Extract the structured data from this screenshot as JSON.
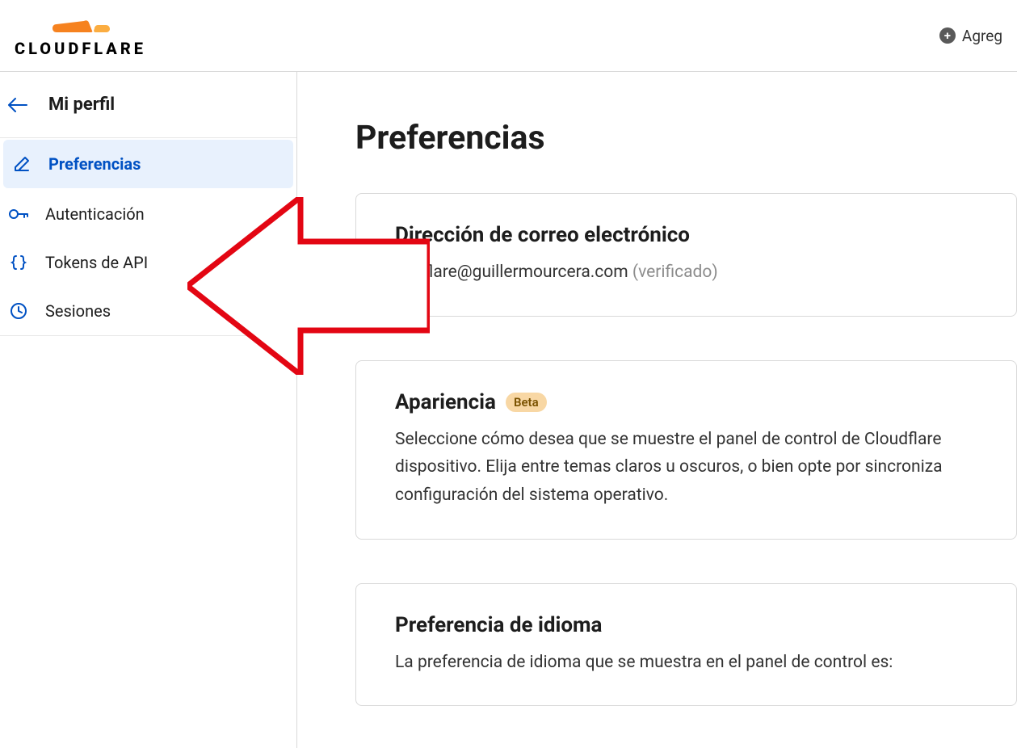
{
  "header": {
    "brand": "CLOUDFLARE",
    "action_label": "Agreg"
  },
  "sidebar": {
    "title": "Mi perfil",
    "items": [
      {
        "label": "Preferencias",
        "active": true
      },
      {
        "label": "Autenticación",
        "active": false
      },
      {
        "label": "Tokens de API",
        "active": false
      },
      {
        "label": "Sesiones",
        "active": false
      }
    ]
  },
  "main": {
    "page_title": "Preferencias",
    "email_card": {
      "title": "Dirección de correo electrónico",
      "email": "oudflare@guillermourcera.com",
      "verified_label": "(verificado)"
    },
    "appearance_card": {
      "title": "Apariencia",
      "badge": "Beta",
      "description": "Seleccione cómo desea que se muestre el panel de control de Cloudflare dispositivo. Elija entre temas claros u oscuros, o bien opte por sincroniza configuración del sistema operativo."
    },
    "language_card": {
      "title": "Preferencia de idioma",
      "description": "La preferencia de idioma que se muestra en el panel de control es:"
    }
  }
}
